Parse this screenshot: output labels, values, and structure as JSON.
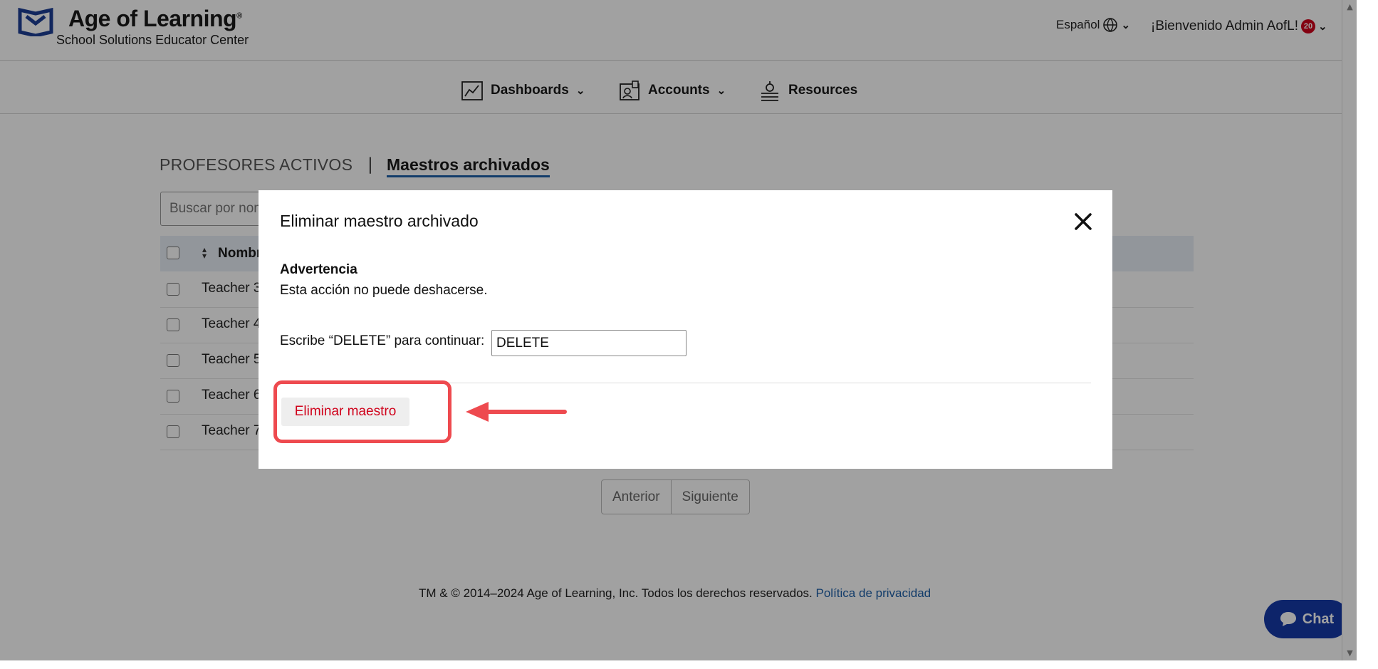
{
  "header": {
    "logo_title": "Age of Learning",
    "logo_reg": "®",
    "logo_subtitle": "School Solutions Educator Center",
    "language": "Español",
    "welcome": "¡Bienvenido Admin AofL!",
    "notification_count": "20"
  },
  "nav": {
    "items": [
      {
        "label": "Dashboards",
        "icon": "chart-icon",
        "has_dropdown": true
      },
      {
        "label": "Accounts",
        "icon": "accounts-icon",
        "has_dropdown": true
      },
      {
        "label": "Resources",
        "icon": "resources-icon",
        "has_dropdown": false
      }
    ]
  },
  "tabs": {
    "active": "PROFESORES ACTIVOS",
    "separator": "|",
    "archived": "Maestros archivados"
  },
  "search": {
    "placeholder": "Buscar por nom"
  },
  "table": {
    "header_label": "Nombr",
    "rows": [
      "Teacher 3",
      "Teacher 4",
      "Teacher 5",
      "Teacher 6",
      "Teacher 7"
    ]
  },
  "pagination": {
    "prev": "Anterior",
    "next": "Siguiente"
  },
  "footer": {
    "copyright": "TM & © 2014–2024 Age of Learning, Inc. Todos los derechos reservados.",
    "privacy_link": "Política de privacidad"
  },
  "chat": {
    "label": "Chat"
  },
  "modal": {
    "title": "Eliminar maestro archivado",
    "warning_title": "Advertencia",
    "warning_text": "Esta acción no puede deshacerse.",
    "confirm_label": "Escribe “DELETE” para continuar:",
    "confirm_value": "DELETE",
    "delete_button": "Eliminar maestro"
  },
  "colors": {
    "brand_blue": "#1d5fa8",
    "danger_red": "#d0021b",
    "annotation_red": "#ee4a4f",
    "chat_blue": "#1539a8"
  }
}
